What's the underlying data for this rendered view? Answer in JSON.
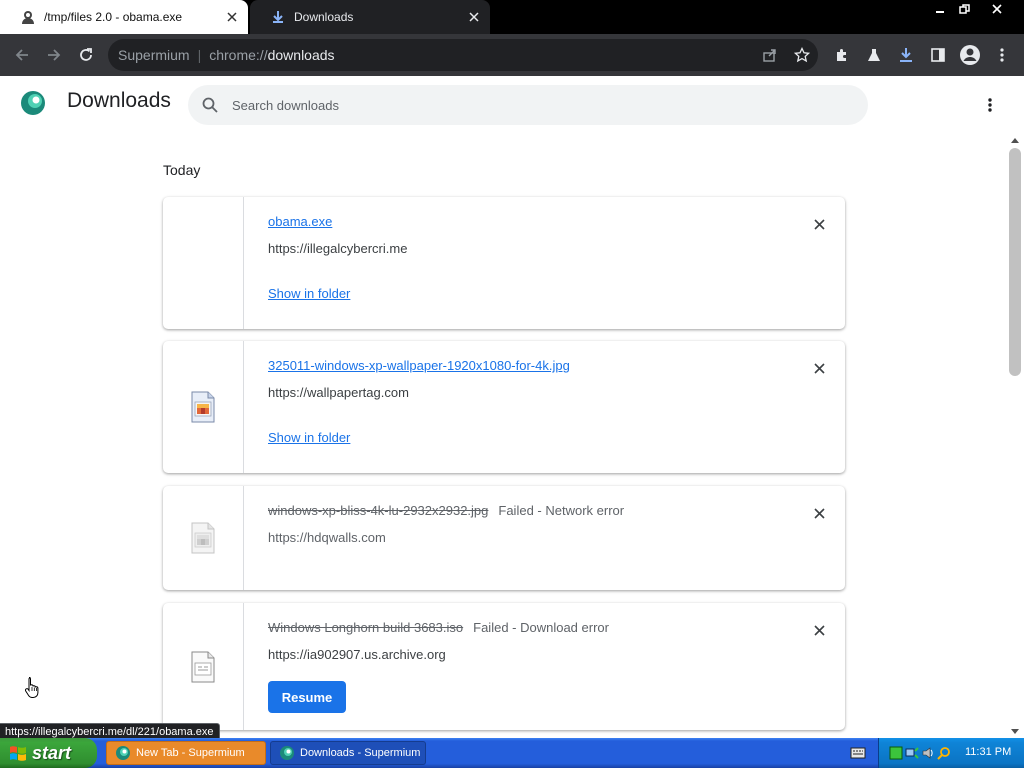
{
  "window": {
    "tabs": [
      {
        "title": "/tmp/files 2.0 - obama.exe",
        "active": false
      },
      {
        "title": "Downloads",
        "active": true
      }
    ],
    "controls": {
      "minimize": "minimize",
      "restore": "restore",
      "close": "close"
    }
  },
  "toolbar": {
    "browser_name": "Supermium",
    "url_scheme": "chrome://",
    "url_host": "downloads",
    "icons": [
      "back-icon",
      "forward-icon",
      "reload-icon",
      "share-icon",
      "star-icon",
      "extensions-icon",
      "labs-icon",
      "download-icon",
      "side-panel-icon",
      "profile-icon",
      "menu-icon"
    ]
  },
  "page": {
    "title": "Downloads",
    "search_placeholder": "Search downloads"
  },
  "downloads": {
    "date_header": "Today",
    "items": [
      {
        "filename": "obama.exe",
        "source": "https://illegalcybercri.me",
        "status": "",
        "action": "Show in folder",
        "state": "complete"
      },
      {
        "filename": "325011-windows-xp-wallpaper-1920x1080-for-4k.jpg",
        "source": "https://wallpapertag.com",
        "status": "",
        "action": "Show in folder",
        "state": "complete"
      },
      {
        "filename": "windows-xp-bliss-4k-lu-2932x2932.jpg",
        "source": "https://hdqwalls.com",
        "status": "Failed - Network error",
        "action": "",
        "state": "failed"
      },
      {
        "filename": "Windows Longhorn build 3683.iso",
        "source": "https://ia902907.us.archive.org",
        "status": "Failed - Download error",
        "action": "Resume",
        "state": "failed"
      }
    ]
  },
  "status_bubble": "https://illegalcybercri.me/dl/221/obama.exe",
  "taskbar": {
    "start_label": "start",
    "tasks": [
      {
        "label": "New Tab - Supermium",
        "active": false
      },
      {
        "label": "Downloads - Supermium",
        "active": true
      }
    ],
    "clock": "11:31 PM"
  },
  "colors": {
    "accent": "#1a73e8",
    "tab_bar": "#000000",
    "toolbar": "#35363a",
    "taskbar": "#245edb",
    "start_button": "#3ba63b"
  }
}
